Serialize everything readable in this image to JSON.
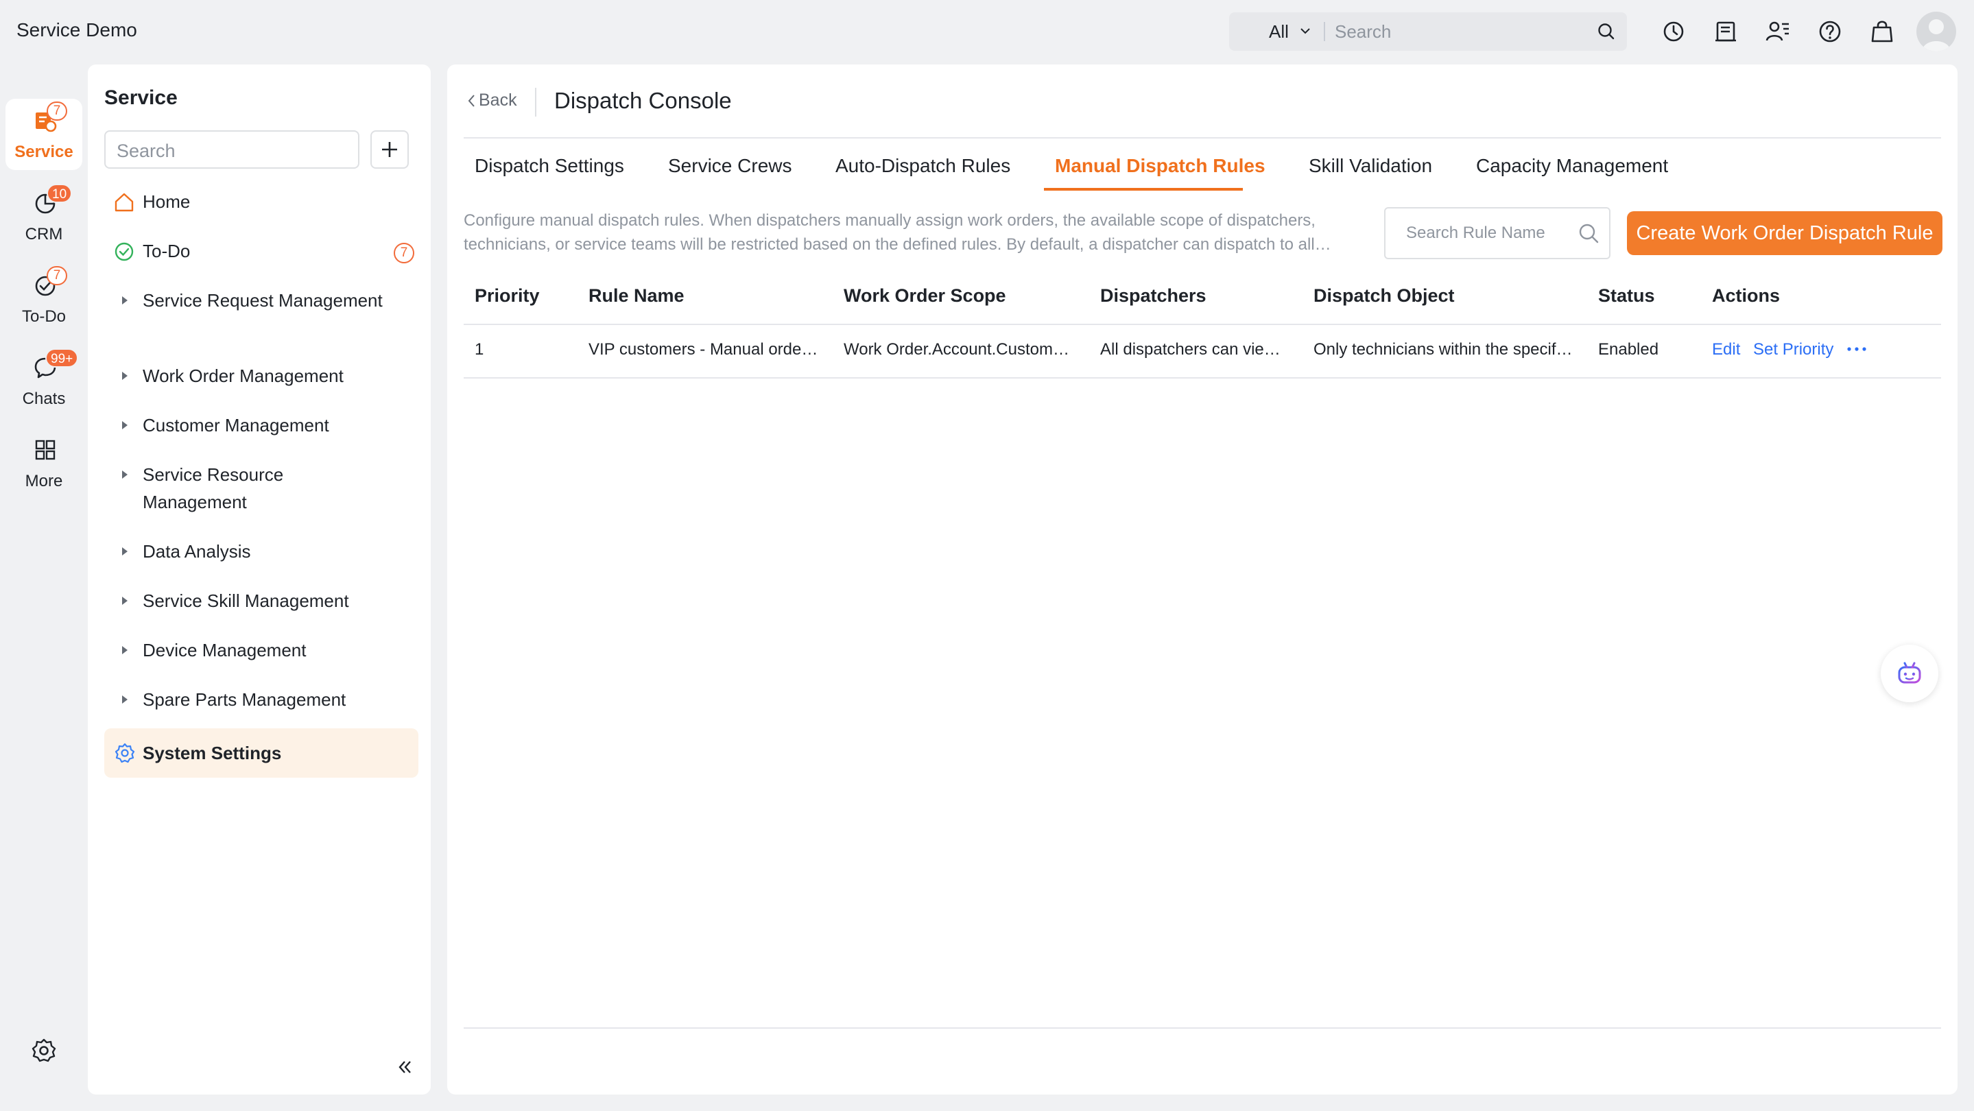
{
  "app": {
    "name": "Service Demo"
  },
  "global_search": {
    "scope": "All",
    "placeholder": "Search"
  },
  "top_icons": [
    "history-icon",
    "notes-icon",
    "contacts-icon",
    "help-icon",
    "store-icon"
  ],
  "rail": {
    "items": [
      {
        "label": "Service",
        "badge": "7",
        "icon": "service-icon",
        "active": true
      },
      {
        "label": "CRM",
        "badge": "10",
        "icon": "crm-icon"
      },
      {
        "label": "To-Do",
        "badge": "7",
        "icon": "todo-icon"
      },
      {
        "label": "Chats",
        "badge": "99+",
        "icon": "chat-icon"
      },
      {
        "label": "More",
        "icon": "grid-icon"
      }
    ]
  },
  "sidebar": {
    "title": "Service",
    "search_placeholder": "Search",
    "items": [
      {
        "label": "Home",
        "icon": "home-icon"
      },
      {
        "label": "To-Do",
        "icon": "check-circle-icon",
        "count": "7"
      },
      {
        "label": "Service Request Management"
      },
      {
        "label": "Work Order Management"
      },
      {
        "label": "Customer Management"
      },
      {
        "label": "Service Resource Management"
      },
      {
        "label": "Data Analysis"
      },
      {
        "label": "Service Skill Management"
      },
      {
        "label": "Device Management"
      },
      {
        "label": "Spare Parts Management"
      },
      {
        "label": "System Settings",
        "icon": "gear-icon",
        "active": true
      }
    ]
  },
  "main": {
    "back_label": "Back",
    "title": "Dispatch Console",
    "tabs": [
      {
        "label": "Dispatch Settings"
      },
      {
        "label": "Service Crews"
      },
      {
        "label": "Auto-Dispatch Rules"
      },
      {
        "label": "Manual Dispatch Rules",
        "active": true
      },
      {
        "label": "Skill Validation"
      },
      {
        "label": "Capacity Management"
      }
    ],
    "description": "Configure manual dispatch rules. When dispatchers manually assign work orders, the available scope of dispatchers, technicians, or service teams will be restricted based on the defined rules. By default, a dispatcher can dispatch to all…",
    "rule_search_placeholder": "Search Rule Name",
    "create_button": "Create Work Order Dispatch Rule",
    "table": {
      "columns": [
        "Priority",
        "Rule Name",
        "Work Order Scope",
        "Dispatchers",
        "Dispatch Object",
        "Status",
        "Actions"
      ],
      "rows": [
        {
          "priority": "1",
          "rule_name": "VIP customers - Manual orde…",
          "scope": "Work Order.Account.Custom…",
          "dispatchers": "All dispatchers can vie…",
          "dispatch_object": "Only technicians within the specif…",
          "status": "Enabled",
          "actions": [
            "Edit",
            "Set Priority"
          ]
        }
      ]
    }
  },
  "colors": {
    "accent": "#f0701d",
    "link": "#2b6ef5",
    "badge": "#f26b3a"
  }
}
